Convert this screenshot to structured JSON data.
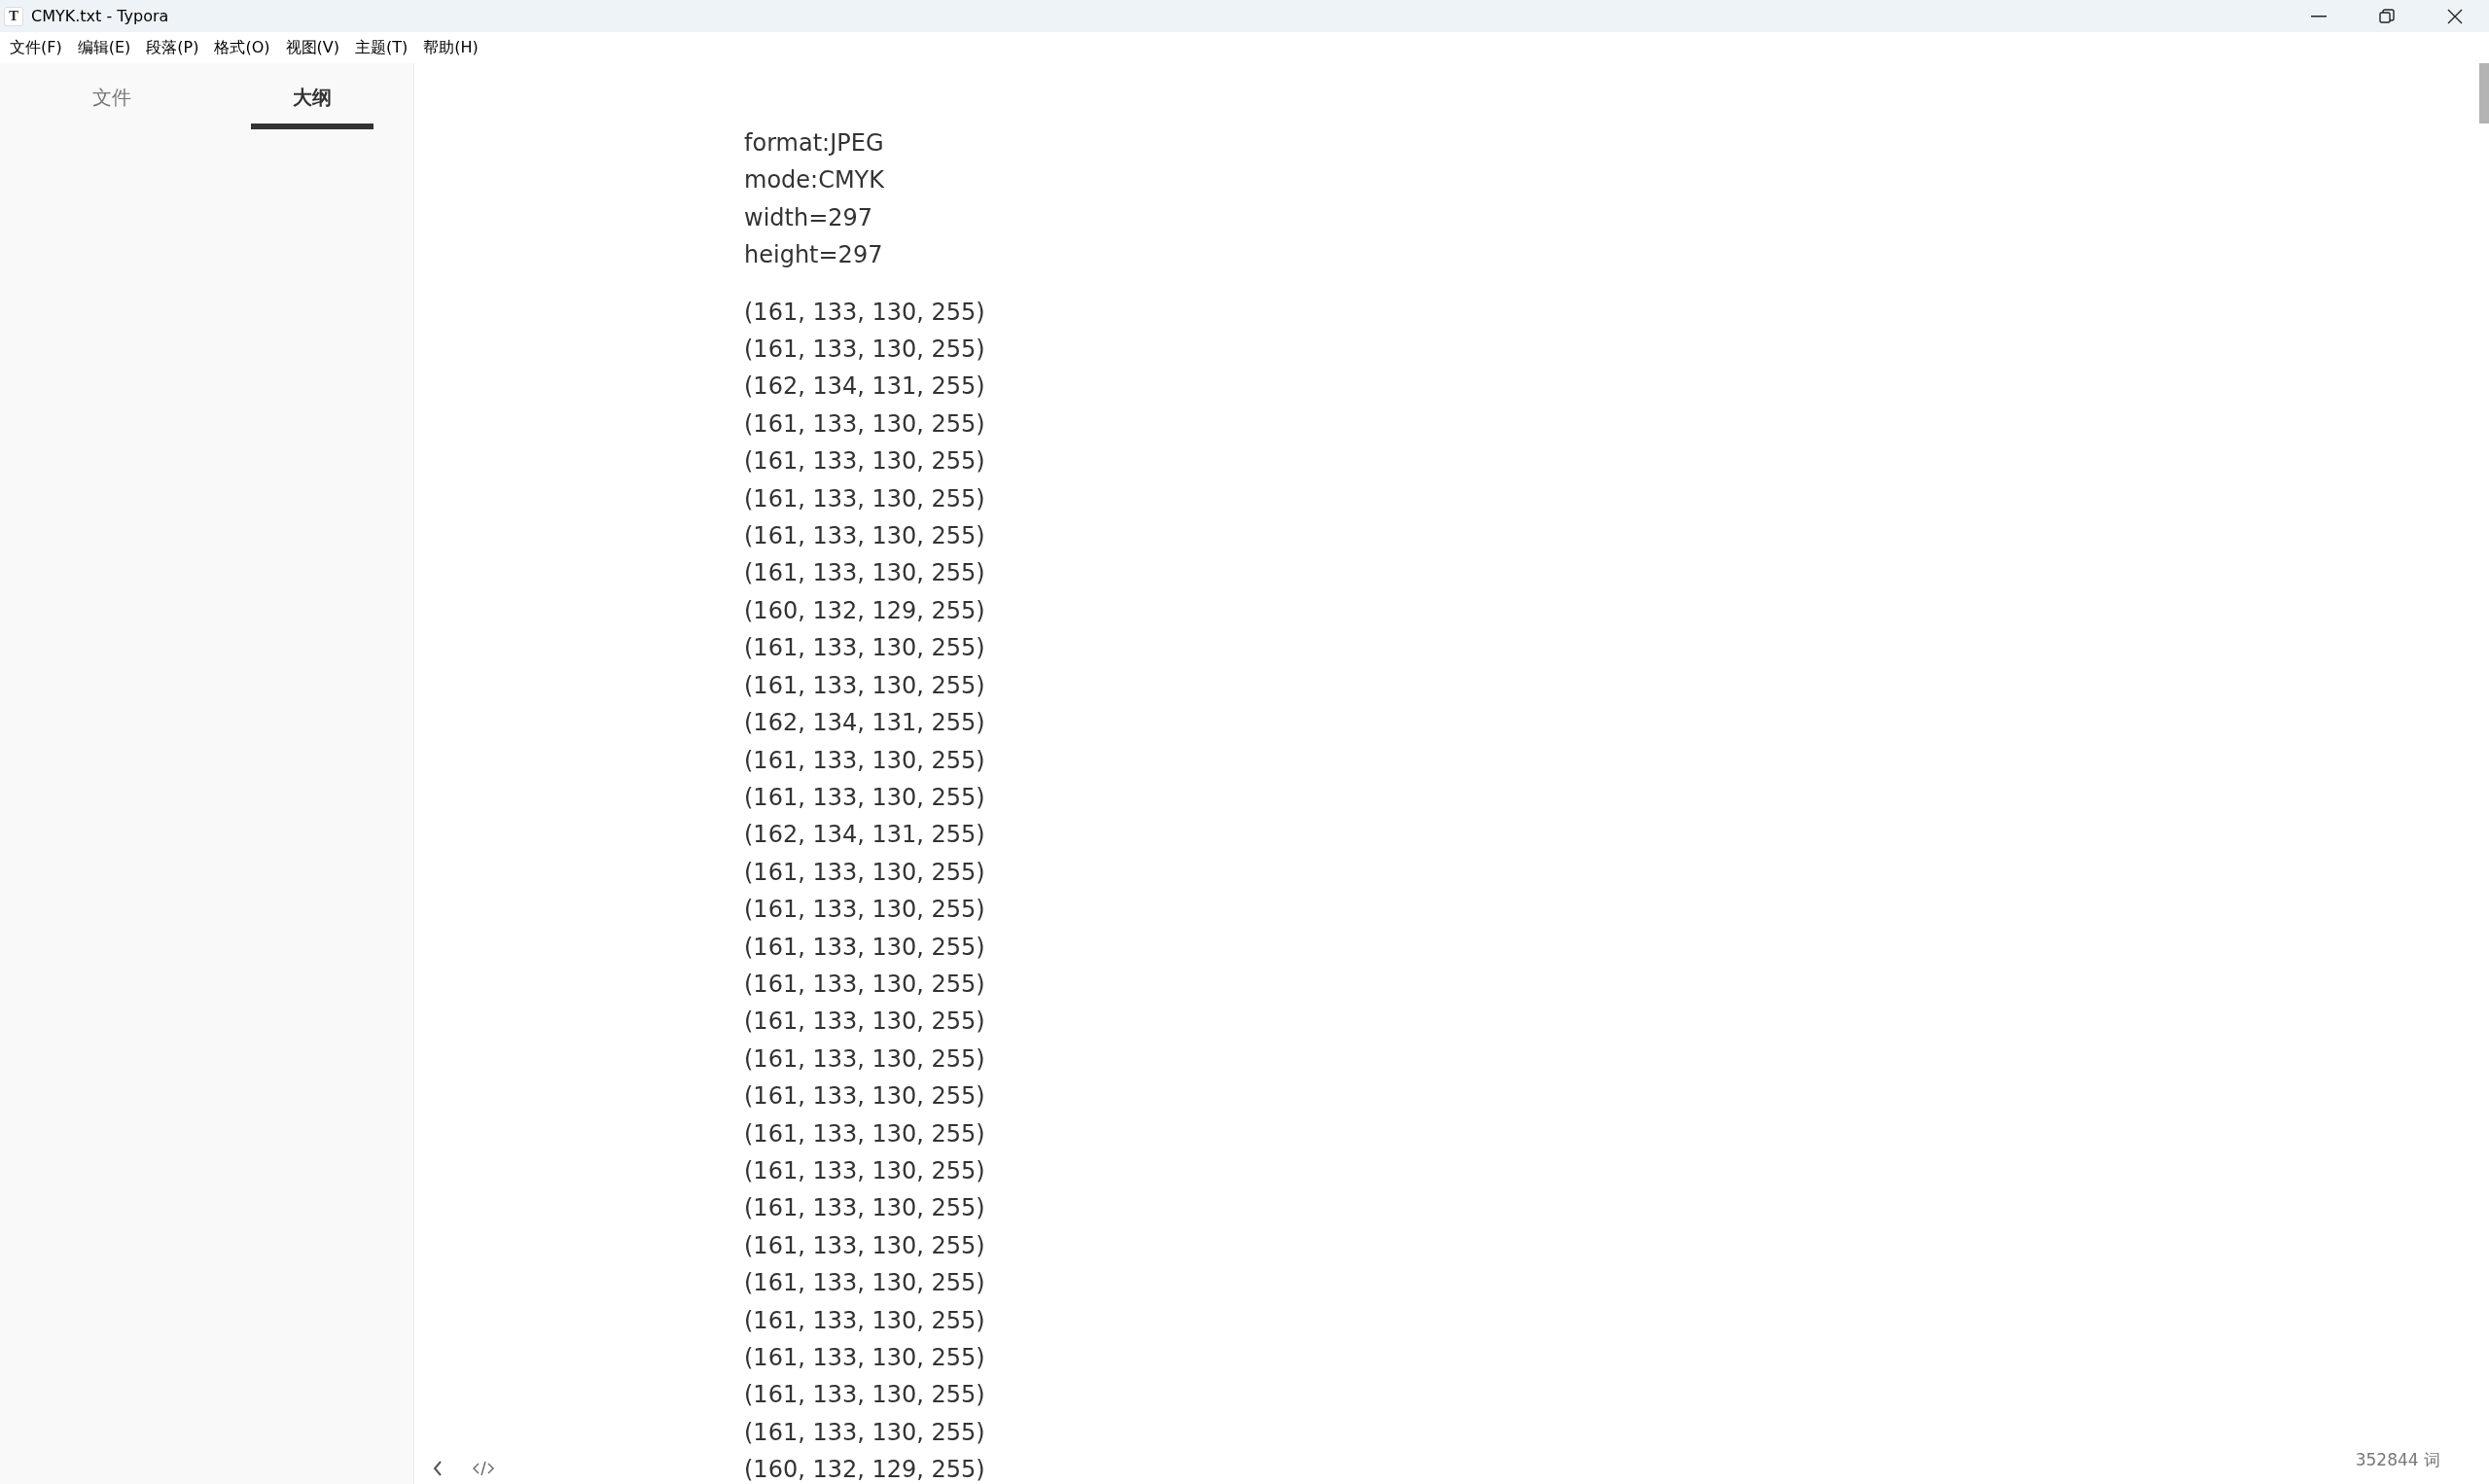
{
  "window": {
    "title": "CMYK.txt - Typora",
    "app_icon": "T"
  },
  "menu": [
    "文件(F)",
    "编辑(E)",
    "段落(P)",
    "格式(O)",
    "视图(V)",
    "主题(T)",
    "帮助(H)"
  ],
  "sidebar": {
    "tabs": [
      {
        "label": "文件",
        "selected": false
      },
      {
        "label": "大纲",
        "selected": true
      }
    ]
  },
  "document": {
    "header_lines": [
      "format:JPEG",
      "mode:CMYK",
      "width=297",
      "height=297"
    ],
    "rows": [
      "(161, 133, 130, 255)",
      "(161, 133, 130, 255)",
      "(162, 134, 131, 255)",
      "(161, 133, 130, 255)",
      "(161, 133, 130, 255)",
      "(161, 133, 130, 255)",
      "(161, 133, 130, 255)",
      "(161, 133, 130, 255)",
      "(160, 132, 129, 255)",
      "(161, 133, 130, 255)",
      "(161, 133, 130, 255)",
      "(162, 134, 131, 255)",
      "(161, 133, 130, 255)",
      "(161, 133, 130, 255)",
      "(162, 134, 131, 255)",
      "(161, 133, 130, 255)",
      "(161, 133, 130, 255)",
      "(161, 133, 130, 255)",
      "(161, 133, 130, 255)",
      "(161, 133, 130, 255)",
      "(161, 133, 130, 255)",
      "(161, 133, 130, 255)",
      "(161, 133, 130, 255)",
      "(161, 133, 130, 255)",
      "(161, 133, 130, 255)",
      "(161, 133, 130, 255)",
      "(161, 133, 130, 255)",
      "(161, 133, 130, 255)",
      "(161, 133, 130, 255)",
      "(161, 133, 130, 255)",
      "(161, 133, 130, 255)",
      "(160, 132, 129, 255)"
    ]
  },
  "status_bar": {
    "word_count": "352844 词"
  }
}
